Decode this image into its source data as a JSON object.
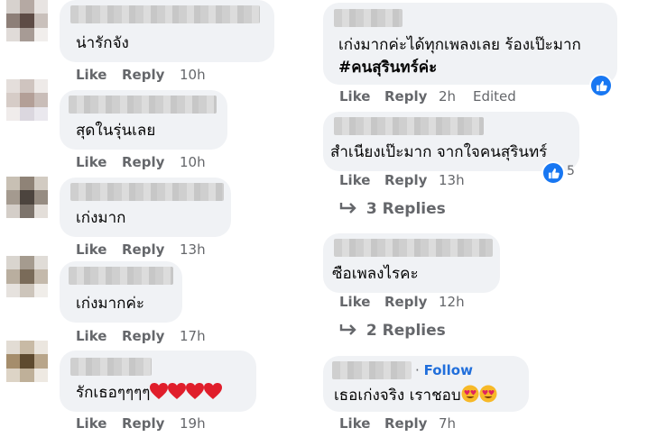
{
  "left_comments": [
    {
      "text": "น่ารักจัง",
      "like": "Like",
      "reply": "Reply",
      "time": "10h"
    },
    {
      "text": "สุดในรุ่นเลย",
      "like": "Like",
      "reply": "Reply",
      "time": "10h"
    },
    {
      "text": "เก่งมาก",
      "like": "Like",
      "reply": "Reply",
      "time": "13h"
    },
    {
      "text": "เก่งมากค่ะ",
      "like": "Like",
      "reply": "Reply",
      "time": "17h"
    },
    {
      "text": "รักเธอๆๆๆๆ",
      "like": "Like",
      "reply": "Reply",
      "time": "19h"
    }
  ],
  "right_comments": [
    {
      "line1": "เก่งมากค่ะได้ทุกเพลงเลย ร้องเป๊ะมาก",
      "line2": "#คนสุรินทร์ค่ะ",
      "like": "Like",
      "reply": "Reply",
      "time": "2h",
      "edited": "Edited"
    },
    {
      "text": "สำเนียงเป๊ะมาก จากใจคนสุรินทร์",
      "like": "Like",
      "reply": "Reply",
      "time": "13h",
      "reactions": "5",
      "replies": "3 Replies"
    },
    {
      "text": "ซือเพลงไรคะ",
      "like": "Like",
      "reply": "Reply",
      "time": "12h",
      "replies": "2 Replies"
    },
    {
      "follow": "Follow",
      "dot": "·",
      "text": "เธอเก่งจริง เราชอบ",
      "like": "Like",
      "reply": "Reply",
      "time": "7h"
    }
  ],
  "colors": {
    "bubble": "#f0f2f5",
    "muted": "#65676b",
    "link": "#216fdb",
    "like": "#1877f2"
  },
  "icons": {
    "like": "thumbs-up-icon",
    "reply_arrow": "reply-arrow-icon",
    "heart": "red-heart-icon",
    "emoji": "heart-eyes-emoji-icon"
  }
}
